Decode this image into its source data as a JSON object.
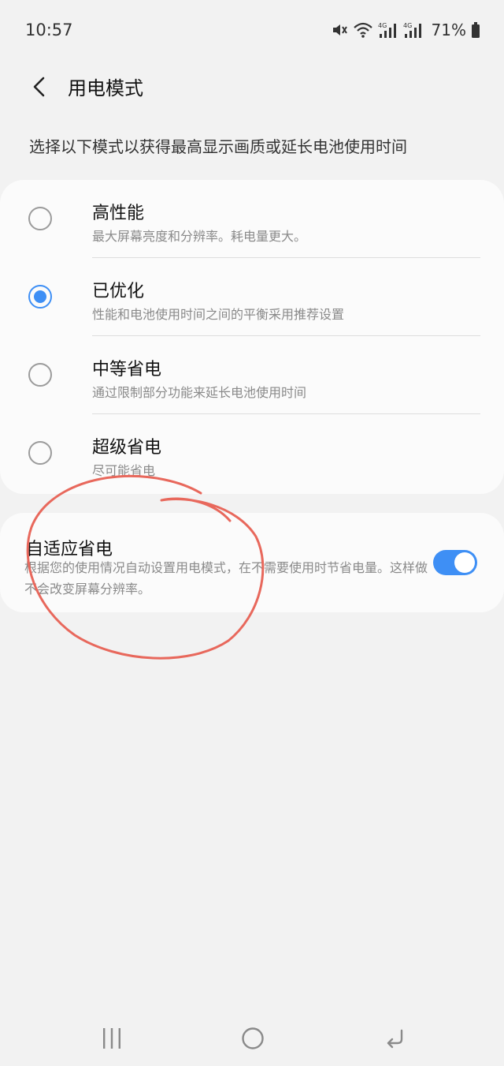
{
  "status_bar": {
    "time": "10:57",
    "battery": "71%",
    "icons": [
      "mute-icon",
      "wifi-icon",
      "signal-4g-icon",
      "signal-4g-icon",
      "battery-icon"
    ]
  },
  "header": {
    "title": "用电模式",
    "back_icon": "back-arrow-icon"
  },
  "description": "选择以下模式以获得最高显示画质或延长电池使用时间",
  "modes": [
    {
      "title": "高性能",
      "subtitle": "最大屏幕亮度和分辨率。耗电量更大。",
      "selected": false
    },
    {
      "title": "已优化",
      "subtitle": "性能和电池使用时间之间的平衡采用推荐设置",
      "selected": true
    },
    {
      "title": "中等省电",
      "subtitle": "通过限制部分功能来延长电池使用时间",
      "selected": false
    },
    {
      "title": "超级省电",
      "subtitle": "尽可能省电",
      "selected": false
    }
  ],
  "adaptive": {
    "title": "自适应省电",
    "subtitle": "根据您的使用情况自动设置用电模式，在不需要使用时节省电量。这样做不会改变屏幕分辨率。",
    "enabled": true
  },
  "nav": {
    "recents_icon": "recents-icon",
    "home_icon": "home-icon",
    "back_icon": "back-icon"
  },
  "colors": {
    "accent": "#3e8ff5",
    "background": "#f2f2f2",
    "card": "#fbfbfb",
    "annotation": "#e8685c"
  }
}
